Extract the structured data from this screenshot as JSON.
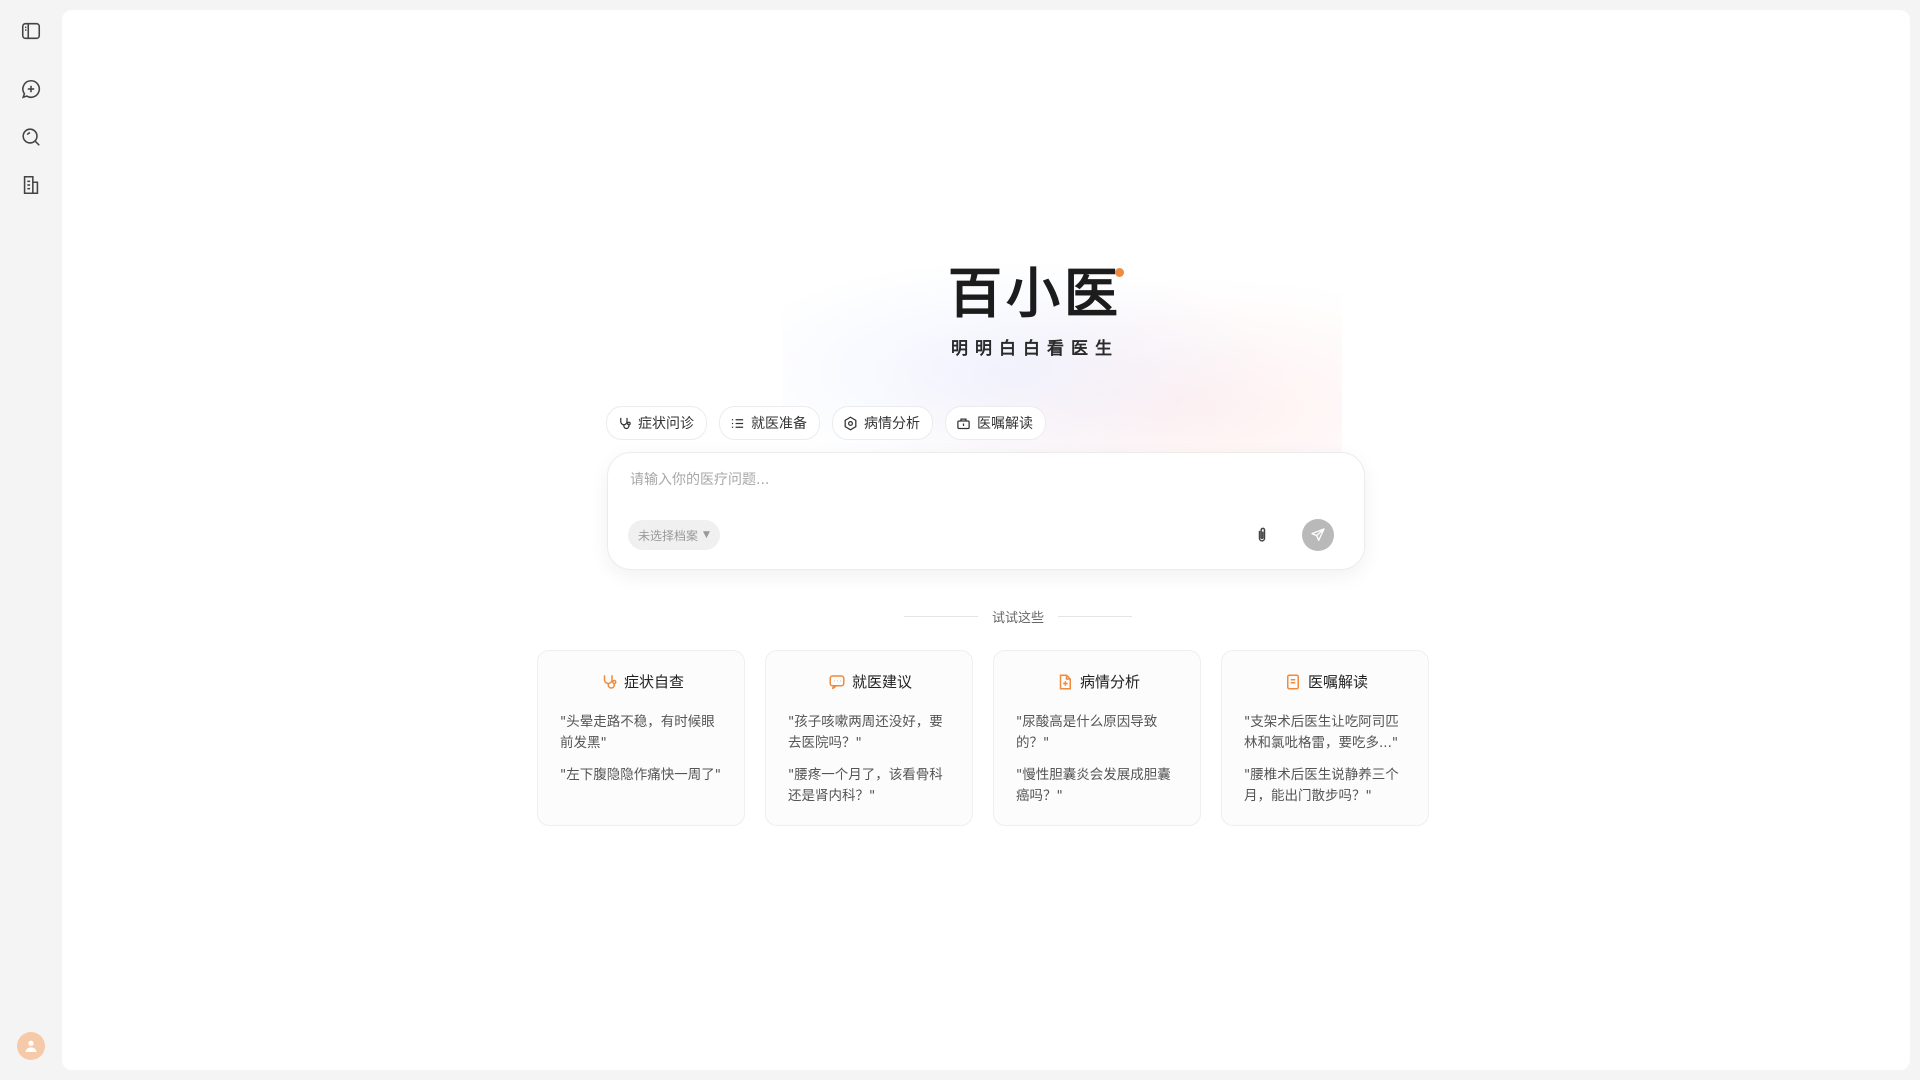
{
  "brand": {
    "name": "百小医",
    "slogan": "明明白白看医生",
    "accent_color": "#f08a3c"
  },
  "sidebar": {
    "items": [
      {
        "name": "sidebar-toggle",
        "icon": "sidebar-panel-icon"
      },
      {
        "name": "new-chat",
        "icon": "chat-plus-icon"
      },
      {
        "name": "search",
        "icon": "search-icon"
      },
      {
        "name": "records",
        "icon": "document-list-icon"
      }
    ],
    "avatar_icon": "user-icon"
  },
  "chips": [
    {
      "label": "症状问诊",
      "icon": "stethoscope-icon"
    },
    {
      "label": "就医准备",
      "icon": "checklist-icon"
    },
    {
      "label": "病情分析",
      "icon": "hexagon-icon"
    },
    {
      "label": "医嘱解读",
      "icon": "briefcase-icon"
    }
  ],
  "composer": {
    "placeholder": "请输入你的医疗问题...",
    "profile_label": "未选择档案",
    "attach_icon": "paperclip-icon",
    "send_icon": "send-icon"
  },
  "suggestions": {
    "label": "试试这些",
    "cards": [
      {
        "title": "症状自查",
        "icon": "stethoscope-icon",
        "questions": [
          "\"头晕走路不稳，有时候眼前发黑\"",
          "\"左下腹隐隐作痛快一周了\""
        ]
      },
      {
        "title": "就医建议",
        "icon": "chat-bubble-icon",
        "questions": [
          "\"孩子咳嗽两周还没好，要去医院吗？\"",
          "\"腰疼一个月了，该看骨科还是肾内科？\""
        ]
      },
      {
        "title": "病情分析",
        "icon": "file-plus-icon",
        "questions": [
          "\"尿酸高是什么原因导致的？\"",
          "\"慢性胆囊炎会发展成胆囊癌吗？\""
        ]
      },
      {
        "title": "医嘱解读",
        "icon": "note-icon",
        "questions": [
          "\"支架术后医生让吃阿司匹林和氯吡格雷，要吃多...\"",
          "\"腰椎术后医生说静养三个月，能出门散步吗？\""
        ]
      }
    ]
  }
}
